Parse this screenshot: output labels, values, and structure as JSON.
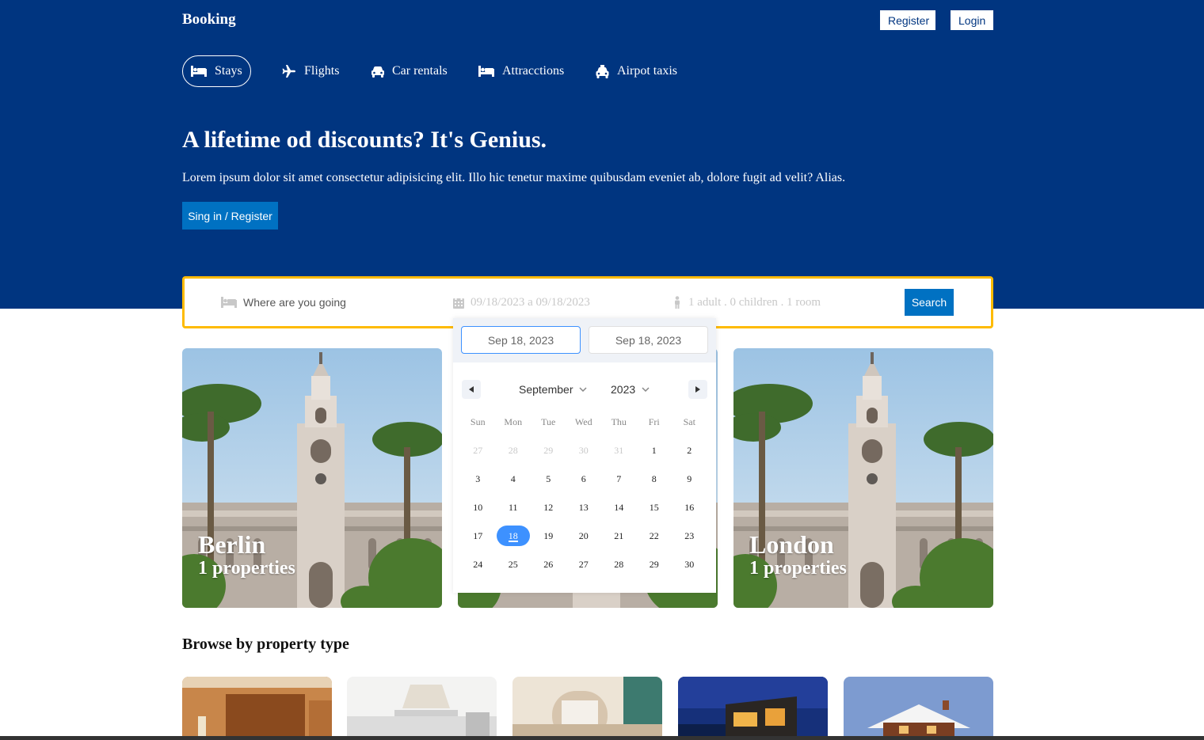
{
  "header": {
    "brand": "Booking",
    "register_label": "Register",
    "login_label": "Login"
  },
  "nav": {
    "items": [
      {
        "label": "Stays",
        "icon": "bed-icon",
        "active": true
      },
      {
        "label": "Flights",
        "icon": "plane-icon",
        "active": false
      },
      {
        "label": "Car rentals",
        "icon": "car-icon",
        "active": false
      },
      {
        "label": "Attracctions",
        "icon": "bed-icon",
        "active": false
      },
      {
        "label": "Airpot taxis",
        "icon": "taxi-icon",
        "active": false
      }
    ]
  },
  "hero": {
    "title": "A lifetime od discounts? It's Genius.",
    "description": "Lorem ipsum dolor sit amet consectetur adipisicing elit. Illo hic tenetur maxime quibusdam eveniet ab, dolore fugit ad velit? Alias.",
    "cta_label": "Sing in / Register"
  },
  "search": {
    "destination_placeholder": "Where are you going",
    "date_range": "09/18/2023 a 09/18/2023",
    "guests": "1 adult . 0 children . 1 room",
    "button_label": "Search"
  },
  "calendar": {
    "start_date": "Sep 18, 2023",
    "end_date": "Sep 18, 2023",
    "month": "September",
    "year": "2023",
    "weekdays": [
      "Sun",
      "Mon",
      "Tue",
      "Wed",
      "Thu",
      "Fri",
      "Sat"
    ],
    "days": [
      {
        "d": "27",
        "muted": true
      },
      {
        "d": "28",
        "muted": true
      },
      {
        "d": "29",
        "muted": true
      },
      {
        "d": "30",
        "muted": true
      },
      {
        "d": "31",
        "muted": true
      },
      {
        "d": "1"
      },
      {
        "d": "2"
      },
      {
        "d": "3"
      },
      {
        "d": "4"
      },
      {
        "d": "5"
      },
      {
        "d": "6"
      },
      {
        "d": "7"
      },
      {
        "d": "8"
      },
      {
        "d": "9"
      },
      {
        "d": "10"
      },
      {
        "d": "11"
      },
      {
        "d": "12"
      },
      {
        "d": "13"
      },
      {
        "d": "14"
      },
      {
        "d": "15"
      },
      {
        "d": "16"
      },
      {
        "d": "17"
      },
      {
        "d": "18",
        "selected": true
      },
      {
        "d": "19"
      },
      {
        "d": "20"
      },
      {
        "d": "21"
      },
      {
        "d": "22"
      },
      {
        "d": "23"
      },
      {
        "d": "24"
      },
      {
        "d": "25"
      },
      {
        "d": "26"
      },
      {
        "d": "27"
      },
      {
        "d": "28"
      },
      {
        "d": "29"
      },
      {
        "d": "30"
      }
    ],
    "accent_color": "#3d91ff"
  },
  "featured": [
    {
      "name": "Berlin",
      "properties": "1 properties"
    },
    {
      "name": "",
      "properties": ""
    },
    {
      "name": "London",
      "properties": "1 properties"
    }
  ],
  "browse": {
    "title": "Browse by property type"
  },
  "colors": {
    "brand_blue": "#003580",
    "button_blue": "#0071c2",
    "search_border": "#febb02"
  }
}
